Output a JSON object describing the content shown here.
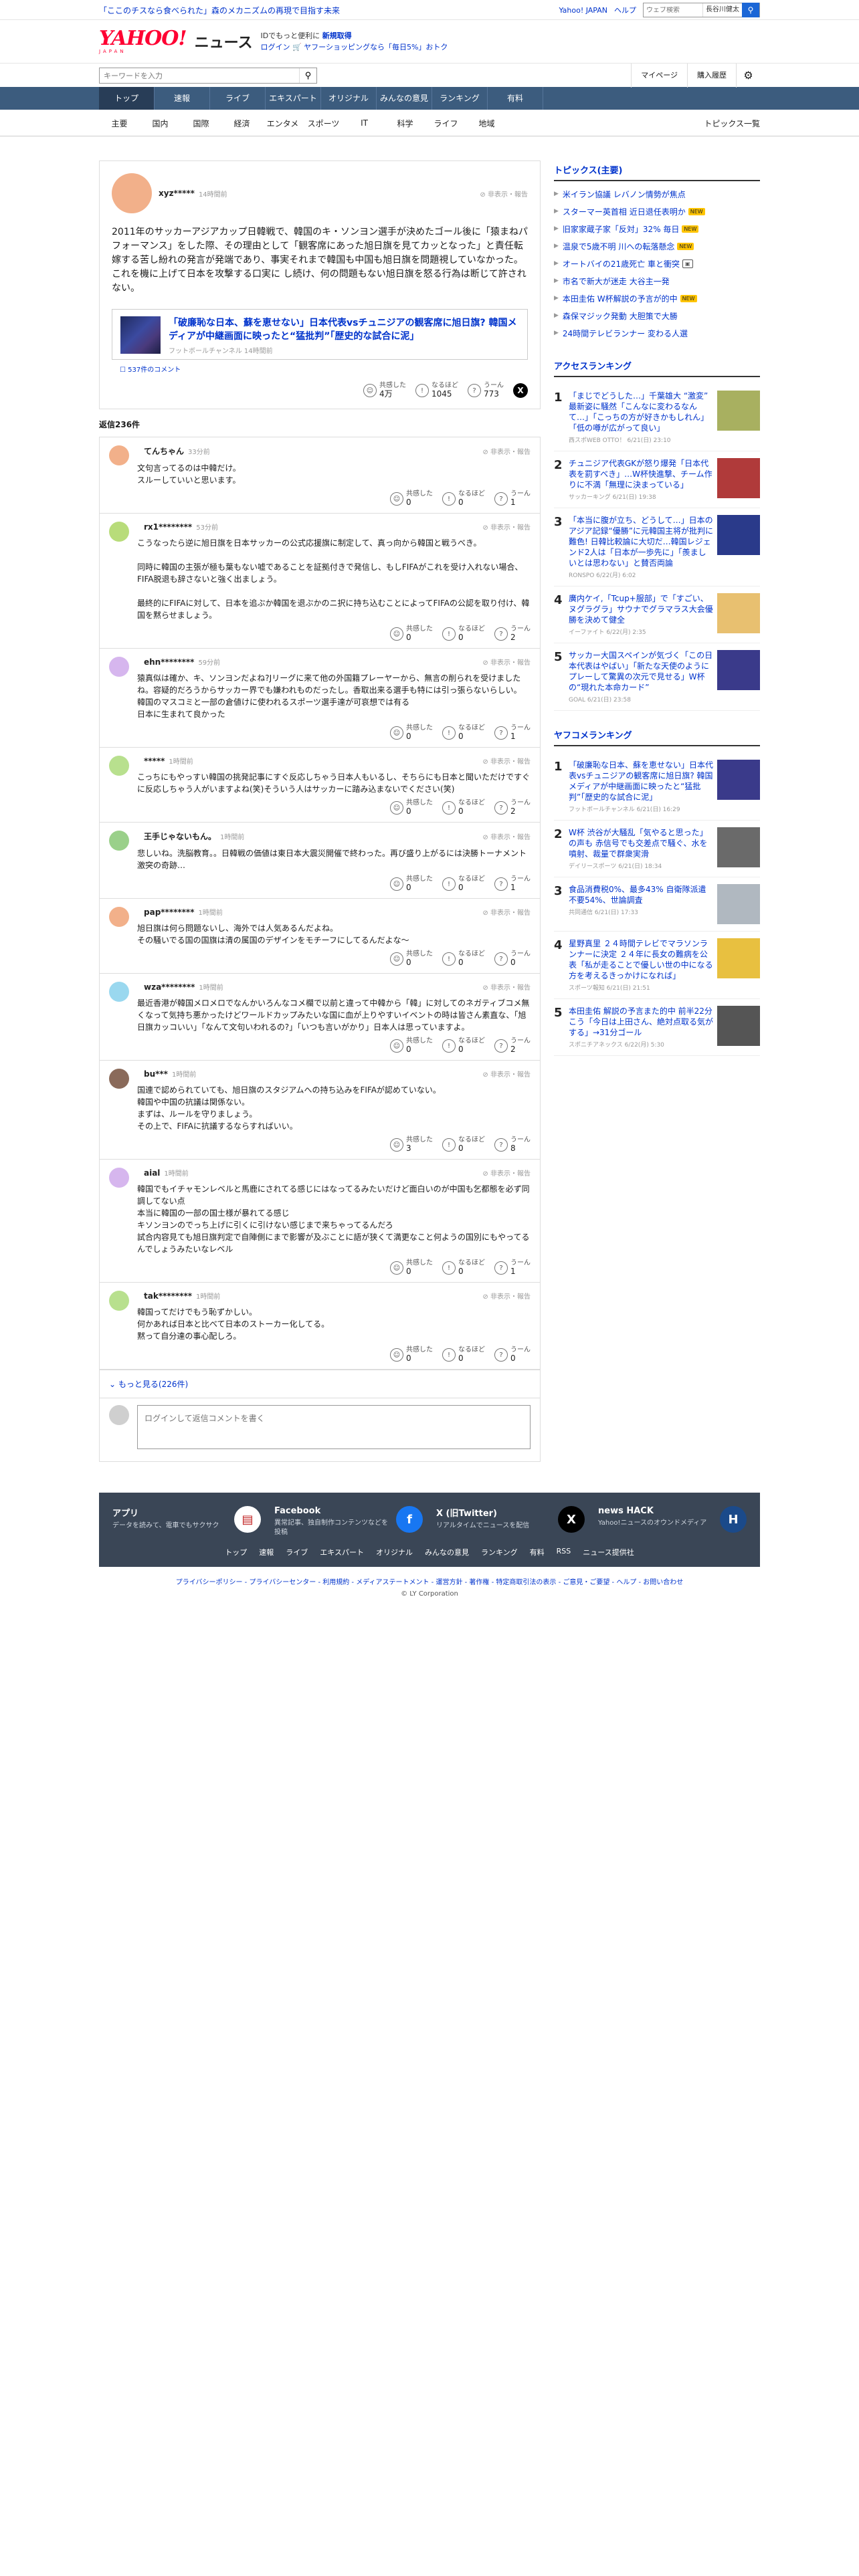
{
  "header": {
    "promo": "「ここのチスなら食べられた」森のメカニズムの再現で目指す未来",
    "links": [
      "Yahoo! JAPAN",
      "ヘルプ"
    ],
    "web_search_placeholder": "ウェブ検索",
    "web_chip": "長谷川健太",
    "logo_text": "YAHOO!",
    "logo_sub": "JAPAN",
    "logo_news": "ニュース",
    "side_line1_pre": "IDでもっと便利に",
    "side_line1_link": "新規取得",
    "side_line2_a": "ログイン",
    "side_line2_b": "ヤフーショッピングなら「毎日5%」おトク",
    "keyword_placeholder": "キーワードを入力",
    "mypage": "マイページ",
    "history": "購入履歴"
  },
  "nav": {
    "tabs": [
      "トップ",
      "速報",
      "ライブ",
      "エキスパート",
      "オリジナル",
      "みんなの意見",
      "ランキング",
      "有料"
    ],
    "categories": [
      "主要",
      "国内",
      "国際",
      "経済",
      "エンタメ",
      "スポーツ",
      "IT",
      "科学",
      "ライフ",
      "地域"
    ],
    "all_topics": "トピックス一覧"
  },
  "main_comment": {
    "user": "xyz*****",
    "time": "14時間前",
    "report": "非表示・報告",
    "body": "2011年のサッカーアジアカップ日韓戦で、韓国のキ・ソンヨン選手が決めたゴール後に「猿まねパフォーマンス」をした際、その理由として「観客席にあった旭日旗を見てカッとなった」と責任転嫁する苦し紛れの発言が発端であり、事実それまで韓国も中国も旭日旗を問題視していなかった。\nこれを機に上げて日本を攻撃する口実に し続け、何の問題もない旭日旗を怒る行為は断じて許されない。",
    "article_title": "「破廉恥な日本、蘇を恵せない」日本代表vsチュニジアの観客席に旭日旗? 韓国メディアが中継画面に映ったと“猛批判”「歴史的な試合に泥」",
    "article_source": "フットボールチャンネル 14時間前",
    "article_comments": "537件のコメント",
    "reactions": [
      {
        "label": "共感した",
        "count": "4万"
      },
      {
        "label": "なるほど",
        "count": "1045"
      },
      {
        "label": "うーん",
        "count": "773"
      }
    ]
  },
  "replies_label": "返信236件",
  "replies": [
    {
      "user": "てんちゃん",
      "time": "33分前",
      "color": "#f2b08a",
      "body": "文句言ってるのは中韓だけ。\nスルーしていいと思います。",
      "r": [
        "0",
        "0",
        "1"
      ]
    },
    {
      "user": "rx1********",
      "time": "53分前",
      "color": "#b8dc7a",
      "body": "こうなったら逆に旭日旗を日本サッカーの公式応援旗に制定して、真っ向から韓国と戦うべき。\n\n同時に韓国の主張が極も葉もない嘘であることを証拠付きで発信し、もしFIFAがこれを受け入れない場合、FIFA脱退も辞さないと強く出ましょう。\n\n最終的にFIFAに対して、日本を追ぶか韓国を退ぶかのニ択に持ち込むことによってFIFAの公認を取り付け、韓国を黙らせましょう。",
      "r": [
        "0",
        "0",
        "2"
      ]
    },
    {
      "user": "ehn********",
      "time": "59分前",
      "color": "#d6b6ee",
      "body": "猿真似は確か、キ、ソンヨンだよね?Jリーグに来て他の外国籍プレーヤーから、無言の削られを受けましたね。容疑的だろうからサッカー界でも嫌われものだったし。香取出来る選手も特には引っ張らないらしい。\n韓国のマスコミと一部の倉値けに使われるスポーツ選手達が可哀想では有る\n日本に生まれて良かった",
      "r": [
        "0",
        "0",
        "1"
      ]
    },
    {
      "user": "*****",
      "time": "1時間前",
      "color": "#b8e08e",
      "body": "こっちにもやっすい韓国の挑発記事にすぐ反応しちゃう日本人もいるし、そちらにも日本と聞いただけですぐに反応しちゃう人がいますよね(笑)そういう人はサッカーに踏み込まないでください(笑)",
      "r": [
        "0",
        "0",
        "2"
      ]
    },
    {
      "user": "王手じゃないもん。",
      "time": "1時間前",
      "color": "#9ad08a",
      "body": "悲しいね。洗脳教育。。日韓戦の価値は東日本大震災開催で終わった。再び盛り上がるには決勝トーナメント激突の奇跡…",
      "r": [
        "0",
        "0",
        "1"
      ]
    },
    {
      "user": "pap********",
      "time": "1時間前",
      "color": "#f2b08a",
      "body": "旭日旗は何ら問題ないし、海外では人気あるんだよね。\nその騒いでる国の国旗は清の属国のデザインをモチーフにしてるんだよな〜",
      "r": [
        "0",
        "0",
        "0"
      ]
    },
    {
      "user": "wza********",
      "time": "1時間前",
      "color": "#9ad8ef",
      "body": "最近香港が韓国メロメロでなんかいろんなコメ欄で以前と違って中韓から「韓」に対してのネガティブコメ無くなって気持ち悪かったけどワールドカップみたいな国に血が上りやすいイベントの時は皆さん素直な、「旭日旗カッコいい」「なんて文句いわれるの?」「いつも言いがかり」日本人は思っていますよ。",
      "r": [
        "0",
        "0",
        "2"
      ]
    },
    {
      "user": "bu***",
      "time": "1時間前",
      "color": "#8a6a5a",
      "body": "国連で認められていても、旭日旗のスタジアムへの持ち込みをFIFAが認めていない。\n韓国や中国の抗議は関係ない。\nまずは、ルールを守りましょう。\nその上で、FIFAに抗議するならすればいい。",
      "r": [
        "3",
        "0",
        "8"
      ]
    },
    {
      "user": "aial",
      "time": "1時間前",
      "color": "#d6b6ee",
      "body": "韓国でもイチャモンレベルと馬鹿にされてる感じにはなってるみたいだけど面白いのが中国も乞都態を必ず同調してない点\n本当に韓国の一部の国士様が暴れてる感じ\nキソンヨンのでっち上げに引くに引けない感じまで来ちゃってるんだろ\n試合内容見ても旭日旗判定で自陣側にまで影響が及ぶことに語が狭くて満更なこと何ようの国別にもやってるんでしょうみたいなレベル",
      "r": [
        "0",
        "0",
        "1"
      ]
    },
    {
      "user": "tak********",
      "time": "1時間前",
      "color": "#b8e08e",
      "body": "韓国ってだけでもう恥ずかしい。\n何かあれば日本と比べて日本のストーカー化してる。\n黙って自分達の事心配しろ。",
      "r": [
        "0",
        "0",
        "0"
      ]
    }
  ],
  "reaction_labels": [
    "共感した",
    "なるほど",
    "うーん"
  ],
  "more_label": "もっと見る(226件)",
  "reply_placeholder": "ログインして返信コメントを書く",
  "sidebar": {
    "topics_title": "トピックス(主要)",
    "topics": [
      {
        "text": "米イラン協議 レバノン情勢が焦点",
        "badge": ""
      },
      {
        "text": "スターマー英首相 近日退任表明か",
        "badge": "NEW"
      },
      {
        "text": "旧家家蔵子家「反対」32% 毎日",
        "badge": "NEW"
      },
      {
        "text": "温泉で5歳不明 川への転落懸念",
        "badge": "NEW"
      },
      {
        "text": "オートバイの21歳死亡 車と衝突",
        "badge": "img"
      },
      {
        "text": "市名で新大が迷走 大谷主一発",
        "badge": ""
      },
      {
        "text": "本田圭佑 W杯解説の予言が的中",
        "badge": "NEW"
      },
      {
        "text": "森保マジック発動 大胆策で大勝",
        "badge": ""
      },
      {
        "text": "24時間テレビランナー 変わる人選",
        "badge": ""
      }
    ],
    "access_title": "アクセスランキング",
    "access": [
      {
        "num": "1",
        "title": "「まじでどうした…」千葉雄大 “激変” 最新姿に騒然「こんなに変わるなんて…」「こっちの方が好きかもしれん」「低の噂が広がって良い」",
        "src": "西スポWEB OTTO！ 6/21(日) 23:10",
        "thumb": "#a8b060"
      },
      {
        "num": "2",
        "title": "チュニジア代表GKが怒り爆発「日本代表を罰すべき」…W杯快進撃、チーム作りに不満「無理に決まっている」",
        "src": "サッカーキング 6/21(日) 19:38",
        "thumb": "#b03a3a"
      },
      {
        "num": "3",
        "title": "「本当に腹が立ち、どうして…」日本のアジア記録“優勝”に元韓国主将が批判に難色! 日韓比較論に大切だ…韓国レジェンド2人は「日本が一歩先に」「羨ましいとは思わない」と賛否両論",
        "src": "RONSPO 6/22(月) 6:02",
        "thumb": "#2a3a8a"
      },
      {
        "num": "4",
        "title": "廣内ケイ,「Tcup+服部」で「すごい、ヌグラグラ」サウナでグラマラス大会優勝を決めて健全",
        "src": "イーファイト 6/22(月) 2:35",
        "thumb": "#e8c070"
      },
      {
        "num": "5",
        "title": "サッカー大国スペインが気づく「この日本代表はやばい」「新たな天使のようにプレーして驚異の次元で見せる」W杯の“現れた本命カード”",
        "src": "GOAL 6/21(日) 23:58",
        "thumb": "#3a3a8a"
      }
    ],
    "yafoo_title": "ヤフコメランキング",
    "yafoo": [
      {
        "num": "1",
        "title": "「破廉恥な日本、蘇を恵せない」日本代表vsチュニジアの観客席に旭日旗? 韓国メディアが中継画面に映ったと“猛批判”「歴史的な試合に泥」",
        "src": "フットボールチャンネル 6/21(日) 16:29",
        "thumb": "#3a3a8a"
      },
      {
        "num": "2",
        "title": "W杯 渋谷が大騒乱「気やると思った」の声も 赤信号でも交差点で騒ぐ、水を噴射、裁量で群衆実滑",
        "src": "デイリースポーツ 6/21(日) 18:34",
        "thumb": "#6a6a6a"
      },
      {
        "num": "3",
        "title": "食品消費税0%、最多43% 自衛隊派遣不要54%、世論調査",
        "src": "共同通信 6/21(日) 17:33",
        "thumb": "#b0b8c0"
      },
      {
        "num": "4",
        "title": "星野真里 ２４時間テレビでマラソンランナーに決定 ２４年に長女の難病を公表「私が走ることで優しい世の中になる方を考えるきっかけになれば」",
        "src": "スポーツ報知 6/21(日) 21:51",
        "thumb": "#e8c040"
      },
      {
        "num": "5",
        "title": "本田圭佑 解説の予言また的中 前半22分こう「今日は上田さん、絶対点取る気がする」→31分ゴール",
        "src": "スポニチアネックス 6/22(月) 5:30",
        "thumb": "#555555"
      }
    ]
  },
  "footer": {
    "apps": [
      {
        "name": "アプリ",
        "desc": "データを読みて、電車でもサクサク",
        "ico": "▤",
        "bg": "#ffffff",
        "fg": "#c02020"
      },
      {
        "name": "Facebook",
        "desc": "異常記事、独自制作コンテンツなどを投稿",
        "ico": "f",
        "bg": "#1877f2",
        "fg": "#ffffff"
      },
      {
        "name": "X (旧Twitter)",
        "desc": "リアルタイムでニュースを配信",
        "ico": "X",
        "bg": "#000000",
        "fg": "#ffffff"
      },
      {
        "name": "news HACK",
        "desc": "Yahoo!ニュースのオウンドメディア",
        "ico": "H",
        "bg": "#1b4a8a",
        "fg": "#ffffff"
      }
    ],
    "links": [
      "トップ",
      "速報",
      "ライブ",
      "エキスパート",
      "オリジナル",
      "みんなの意見",
      "ランキング",
      "有料",
      "RSS",
      "ニュース提供社"
    ],
    "legal": "プライバシーポリシー - プライバシーセンター - 利用規約 - メディアステートメント - 運営方針 - 著作権 - 特定商取引法の表示 - ご意見・ご要望 - ヘルプ - お問い合わせ",
    "copyright": "© LY Corporation"
  }
}
